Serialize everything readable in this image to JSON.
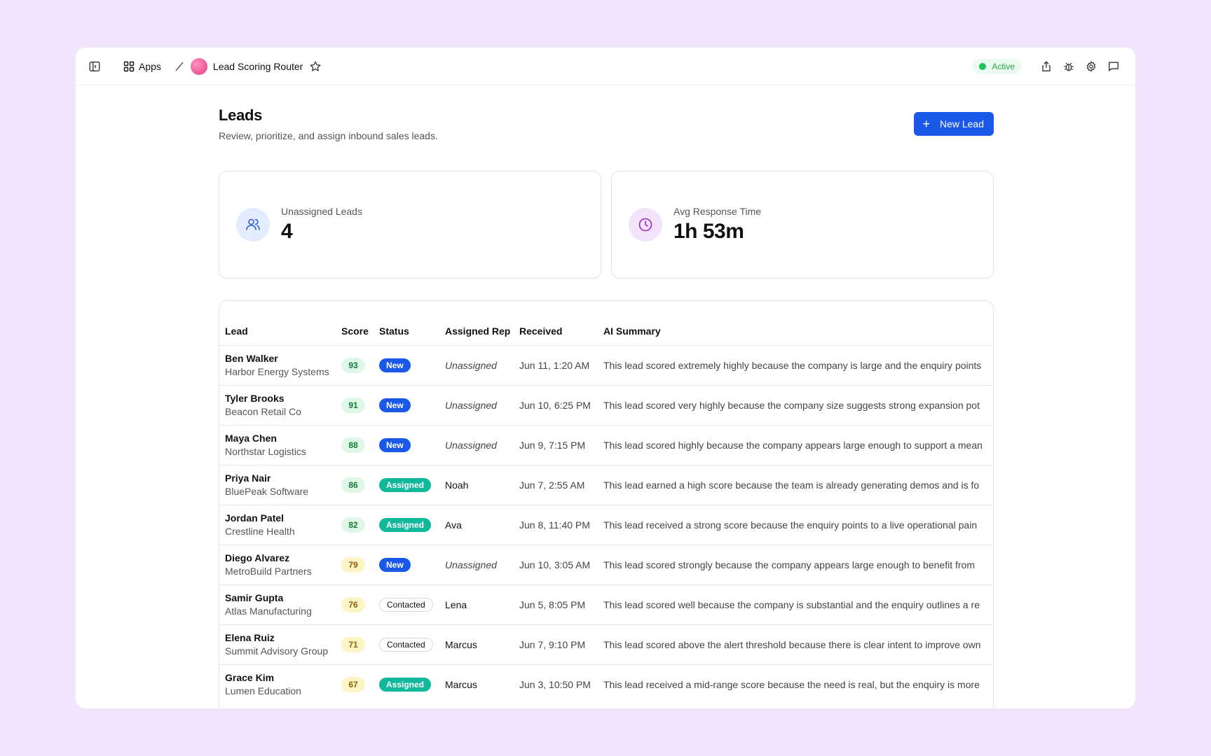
{
  "topbar": {
    "apps_label": "Apps",
    "app_name": "Lead Scoring Router",
    "status": "Active"
  },
  "page": {
    "title": "Leads",
    "subtitle": "Review, prioritize, and assign inbound sales leads.",
    "new_button": "New Lead"
  },
  "stats": [
    {
      "label": "Unassigned Leads",
      "value": "4",
      "icon": "users-icon"
    },
    {
      "label": "Avg Response Time",
      "value": "1h 53m",
      "icon": "clock-icon"
    }
  ],
  "table": {
    "columns": [
      "Lead",
      "Score",
      "Status",
      "Assigned Rep",
      "Received",
      "AI Summary"
    ],
    "rows": [
      {
        "name": "Ben Walker",
        "company": "Harbor Energy Systems",
        "score": "93",
        "score_tone": "green",
        "status": "New",
        "rep": "Unassigned",
        "received": "Jun 11, 1:20 AM",
        "summary": "This lead scored extremely highly because the company is large and the enquiry points"
      },
      {
        "name": "Tyler Brooks",
        "company": "Beacon Retail Co",
        "score": "91",
        "score_tone": "green",
        "status": "New",
        "rep": "Unassigned",
        "received": "Jun 10, 6:25 PM",
        "summary": "This lead scored very highly because the company size suggests strong expansion pot"
      },
      {
        "name": "Maya Chen",
        "company": "Northstar Logistics",
        "score": "88",
        "score_tone": "green",
        "status": "New",
        "rep": "Unassigned",
        "received": "Jun 9, 7:15 PM",
        "summary": "This lead scored highly because the company appears large enough to support a mean"
      },
      {
        "name": "Priya Nair",
        "company": "BluePeak Software",
        "score": "86",
        "score_tone": "green",
        "status": "Assigned",
        "rep": "Noah",
        "received": "Jun 7, 2:55 AM",
        "summary": "This lead earned a high score because the team is already generating demos and is fo"
      },
      {
        "name": "Jordan Patel",
        "company": "Crestline Health",
        "score": "82",
        "score_tone": "green",
        "status": "Assigned",
        "rep": "Ava",
        "received": "Jun 8, 11:40 PM",
        "summary": "This lead received a strong score because the enquiry points to a live operational pain"
      },
      {
        "name": "Diego Alvarez",
        "company": "MetroBuild Partners",
        "score": "79",
        "score_tone": "yellow",
        "status": "New",
        "rep": "Unassigned",
        "received": "Jun 10, 3:05 AM",
        "summary": "This lead scored strongly because the company appears large enough to benefit from"
      },
      {
        "name": "Samir Gupta",
        "company": "Atlas Manufacturing",
        "score": "76",
        "score_tone": "yellow",
        "status": "Contacted",
        "rep": "Lena",
        "received": "Jun 5, 8:05 PM",
        "summary": "This lead scored well because the company is substantial and the enquiry outlines a re"
      },
      {
        "name": "Elena Ruiz",
        "company": "Summit Advisory Group",
        "score": "71",
        "score_tone": "yellow",
        "status": "Contacted",
        "rep": "Marcus",
        "received": "Jun 7, 9:10 PM",
        "summary": "This lead scored above the alert threshold because there is clear intent to improve own"
      },
      {
        "name": "Grace Kim",
        "company": "Lumen Education",
        "score": "67",
        "score_tone": "yellow",
        "status": "Assigned",
        "rep": "Marcus",
        "received": "Jun 3, 10:50 PM",
        "summary": "This lead received a mid-range score because the need is real, but the enquiry is more"
      }
    ]
  }
}
